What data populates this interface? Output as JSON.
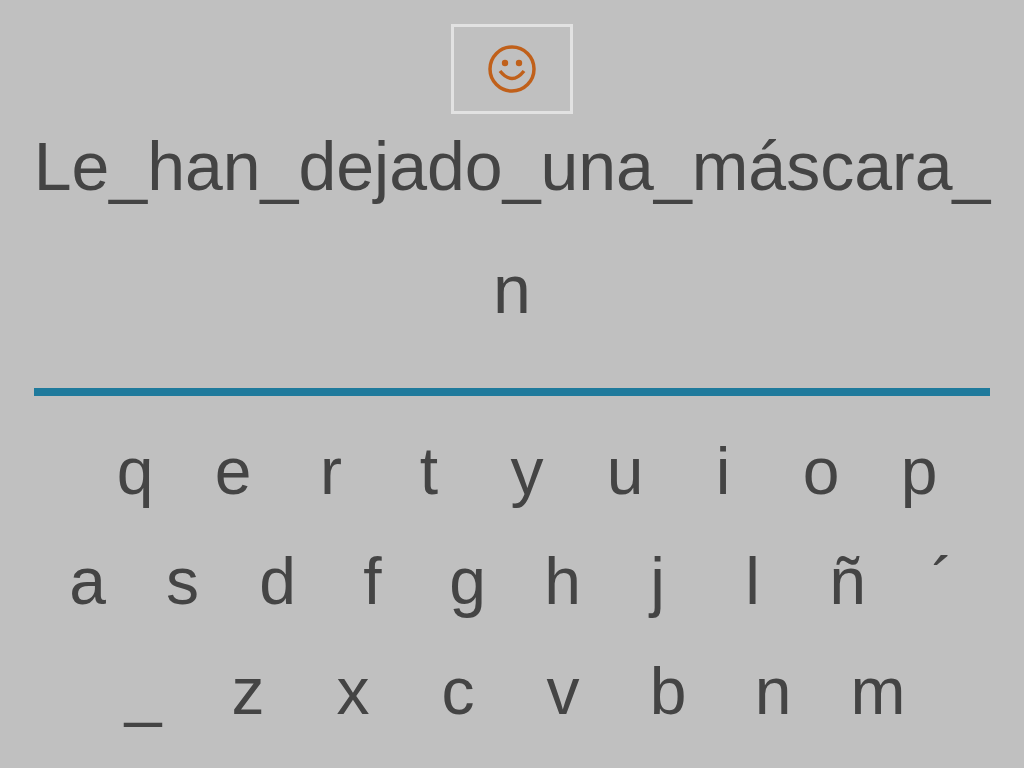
{
  "phrase_lines": [
    "Le_han_dejado_una_máscara_",
    "n"
  ],
  "keyboard": {
    "rows": [
      [
        "q",
        "e",
        "r",
        "t",
        "y",
        "u",
        "i",
        "o",
        "p"
      ],
      [
        "a",
        "s",
        "d",
        "f",
        "g",
        "h",
        "j",
        "l",
        "ñ",
        "´"
      ],
      [
        "_",
        "z",
        "x",
        "c",
        "v",
        "b",
        "n",
        "m"
      ]
    ]
  }
}
